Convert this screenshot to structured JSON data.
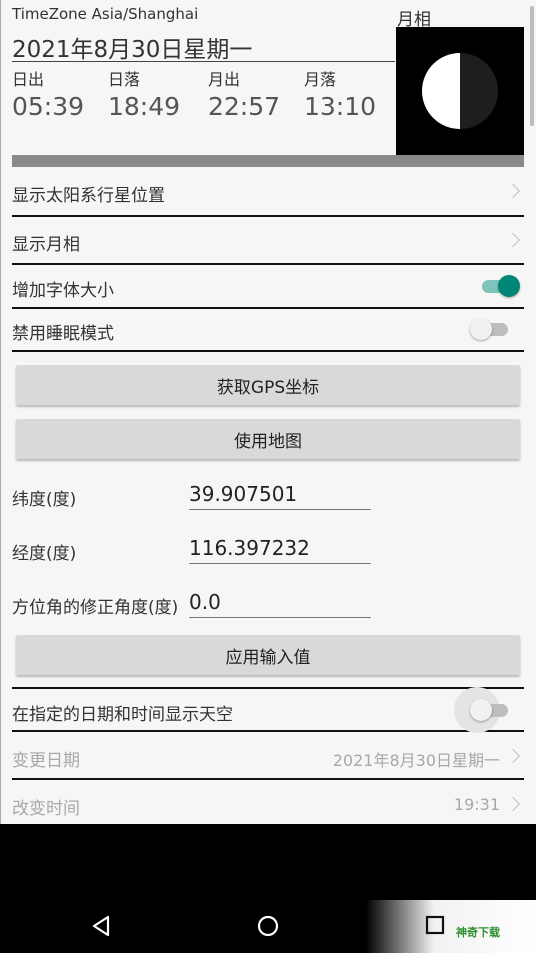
{
  "header": {
    "timezone": "TimeZone Asia/Shanghai",
    "date": "2021年8月30日星期一",
    "sunrise_label": "日出",
    "sunrise_time": "05:39",
    "sunset_label": "日落",
    "sunset_time": "18:49",
    "moonrise_label": "月出",
    "moonrise_time": "22:57",
    "moonset_label": "月落",
    "moonset_time": "13:10",
    "moon_phase_label": "月相"
  },
  "settings": {
    "show_planets": "显示太阳系行星位置",
    "show_moon_phase": "显示月相",
    "increase_font": "增加字体大小",
    "increase_font_on": true,
    "disable_sleep": "禁用睡眠模式",
    "disable_sleep_on": false
  },
  "buttons": {
    "get_gps": "获取GPS坐标",
    "use_map": "使用地图",
    "apply_input": "应用输入值"
  },
  "inputs": {
    "latitude_label": "纬度(度)",
    "latitude_value": "39.907501",
    "longitude_label": "经度(度)",
    "longitude_value": "116.397232",
    "azimuth_label": "方位角的修正角度(度)",
    "azimuth_value": "0.0"
  },
  "sky": {
    "show_at_time": "在指定的日期和时间显示天空",
    "show_at_time_on": false,
    "change_date_label": "变更日期",
    "change_date_value": "2021年8月30日星期一",
    "change_time_label": "改变时间",
    "change_time_value": "19:31"
  },
  "nav": {
    "back_icon": "back-triangle-icon",
    "home_icon": "home-circle-icon",
    "recents_icon": "recents-square-icon",
    "watermark": "神奇下载"
  },
  "colors": {
    "accent": "#008577",
    "accent_track": "#7fc4bb"
  }
}
